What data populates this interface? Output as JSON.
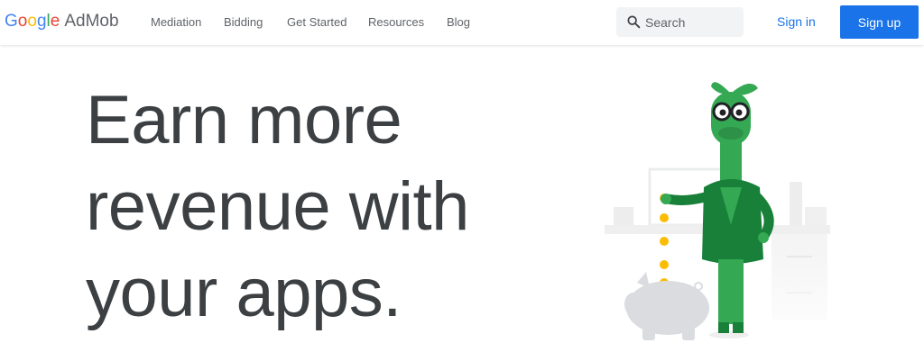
{
  "header": {
    "logo": {
      "google": [
        "G",
        "o",
        "o",
        "g",
        "l",
        "e"
      ],
      "google_colors": [
        "#4285f4",
        "#ea4335",
        "#fbbc05",
        "#4285f4",
        "#34a853",
        "#ea4335"
      ],
      "product": "AdMob"
    },
    "nav": [
      {
        "label": "Mediation"
      },
      {
        "label": "Bidding"
      },
      {
        "label": "Get Started"
      },
      {
        "label": "Resources"
      },
      {
        "label": "Blog"
      }
    ],
    "search": {
      "placeholder": "Search"
    },
    "sign_in": "Sign in",
    "sign_up": "Sign up"
  },
  "hero": {
    "title_lines": [
      "Earn more",
      "revenue with",
      "your apps."
    ]
  },
  "colors": {
    "accent": "#1a73e8",
    "text": "#3c4043",
    "nav_text": "#5f6368",
    "mascot_green": "#34a853",
    "coin": "#fbbc04"
  },
  "icons": [
    "search-icon"
  ]
}
